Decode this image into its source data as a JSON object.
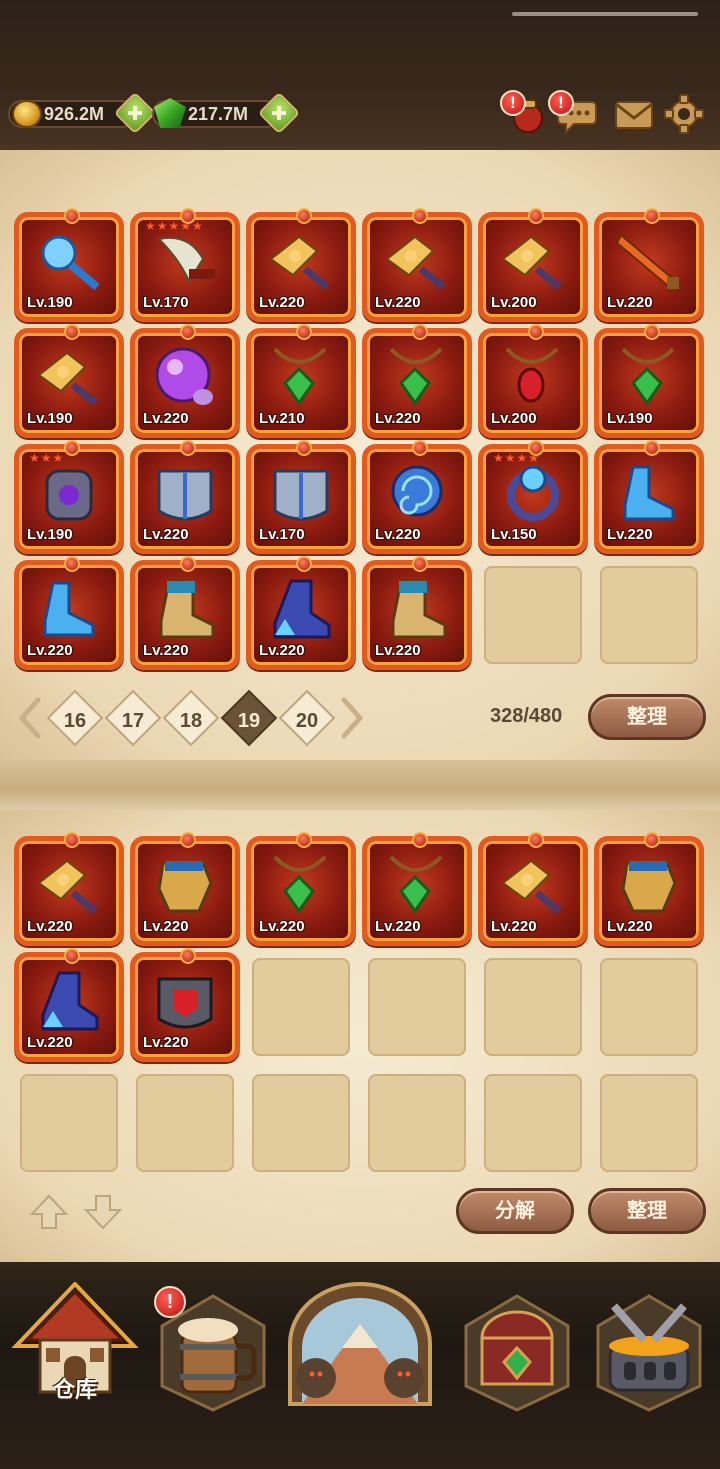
{
  "currencies": {
    "gold": "926.2M",
    "gems": "217.7M"
  },
  "top_icons": [
    "bag-alert-icon",
    "chat-icon",
    "mail-icon",
    "settings-icon"
  ],
  "alert_mark": "!",
  "warehouse": {
    "items": [
      {
        "level": "Lv.190",
        "type": "ice-mace",
        "stars": ""
      },
      {
        "level": "Lv.170",
        "type": "bone-blade",
        "stars": "★★★★★"
      },
      {
        "level": "Lv.220",
        "type": "gold-dagger",
        "stars": ""
      },
      {
        "level": "Lv.220",
        "type": "gold-dagger",
        "stars": ""
      },
      {
        "level": "Lv.200",
        "type": "gold-dagger",
        "stars": ""
      },
      {
        "level": "Lv.220",
        "type": "flame-sword",
        "stars": ""
      },
      {
        "level": "Lv.190",
        "type": "gold-dagger",
        "stars": ""
      },
      {
        "level": "Lv.220",
        "type": "purple-orb",
        "stars": ""
      },
      {
        "level": "Lv.210",
        "type": "green-amulet",
        "stars": ""
      },
      {
        "level": "Lv.220",
        "type": "green-amulet",
        "stars": ""
      },
      {
        "level": "Lv.200",
        "type": "red-amulet",
        "stars": ""
      },
      {
        "level": "Lv.190",
        "type": "green-amulet",
        "stars": ""
      },
      {
        "level": "Lv.190",
        "type": "dark-armor",
        "stars": "★★★"
      },
      {
        "level": "Lv.220",
        "type": "steel-armor",
        "stars": ""
      },
      {
        "level": "Lv.170",
        "type": "steel-armor",
        "stars": ""
      },
      {
        "level": "Lv.220",
        "type": "swirl-gloves",
        "stars": ""
      },
      {
        "level": "Lv.150",
        "type": "crystal-ring",
        "stars": "★★★★"
      },
      {
        "level": "Lv.220",
        "type": "ice-boot",
        "stars": ""
      },
      {
        "level": "Lv.220",
        "type": "ice-boot",
        "stars": ""
      },
      {
        "level": "Lv.220",
        "type": "gold-boot",
        "stars": ""
      },
      {
        "level": "Lv.220",
        "type": "crystal-boot",
        "stars": ""
      },
      {
        "level": "Lv.220",
        "type": "gold-boot",
        "stars": ""
      }
    ],
    "empty_slots": 2,
    "pages": [
      "16",
      "17",
      "18",
      "19",
      "20"
    ],
    "active_page": "19",
    "capacity": "328/480",
    "sort_label": "整理"
  },
  "backpack": {
    "items": [
      {
        "level": "Lv.220",
        "type": "gold-dagger"
      },
      {
        "level": "Lv.220",
        "type": "gold-gauntlet"
      },
      {
        "level": "Lv.220",
        "type": "green-amulet"
      },
      {
        "level": "Lv.220",
        "type": "green-amulet"
      },
      {
        "level": "Lv.220",
        "type": "gold-dagger"
      },
      {
        "level": "Lv.220",
        "type": "gold-gauntlet"
      },
      {
        "level": "Lv.220",
        "type": "crystal-boot"
      },
      {
        "level": "Lv.220",
        "type": "red-armor"
      }
    ],
    "empty_slots": 10,
    "decompose_label": "分解",
    "sort_label": "整理"
  },
  "bottom_nav": [
    {
      "label": "仓库",
      "icon": "warehouse-house-icon",
      "active": true
    },
    {
      "label": "",
      "icon": "tavern-mug-icon",
      "alert": true
    },
    {
      "label": "",
      "icon": "adventure-portal-icon"
    },
    {
      "label": "",
      "icon": "treasure-chest-icon"
    },
    {
      "label": "",
      "icon": "forge-anvil-icon"
    }
  ],
  "colors": {
    "slot_border": "#e4591e",
    "parchment": "#ebd8b4",
    "alert_red": "#d2201a",
    "sort_button": "#9c6a50"
  }
}
